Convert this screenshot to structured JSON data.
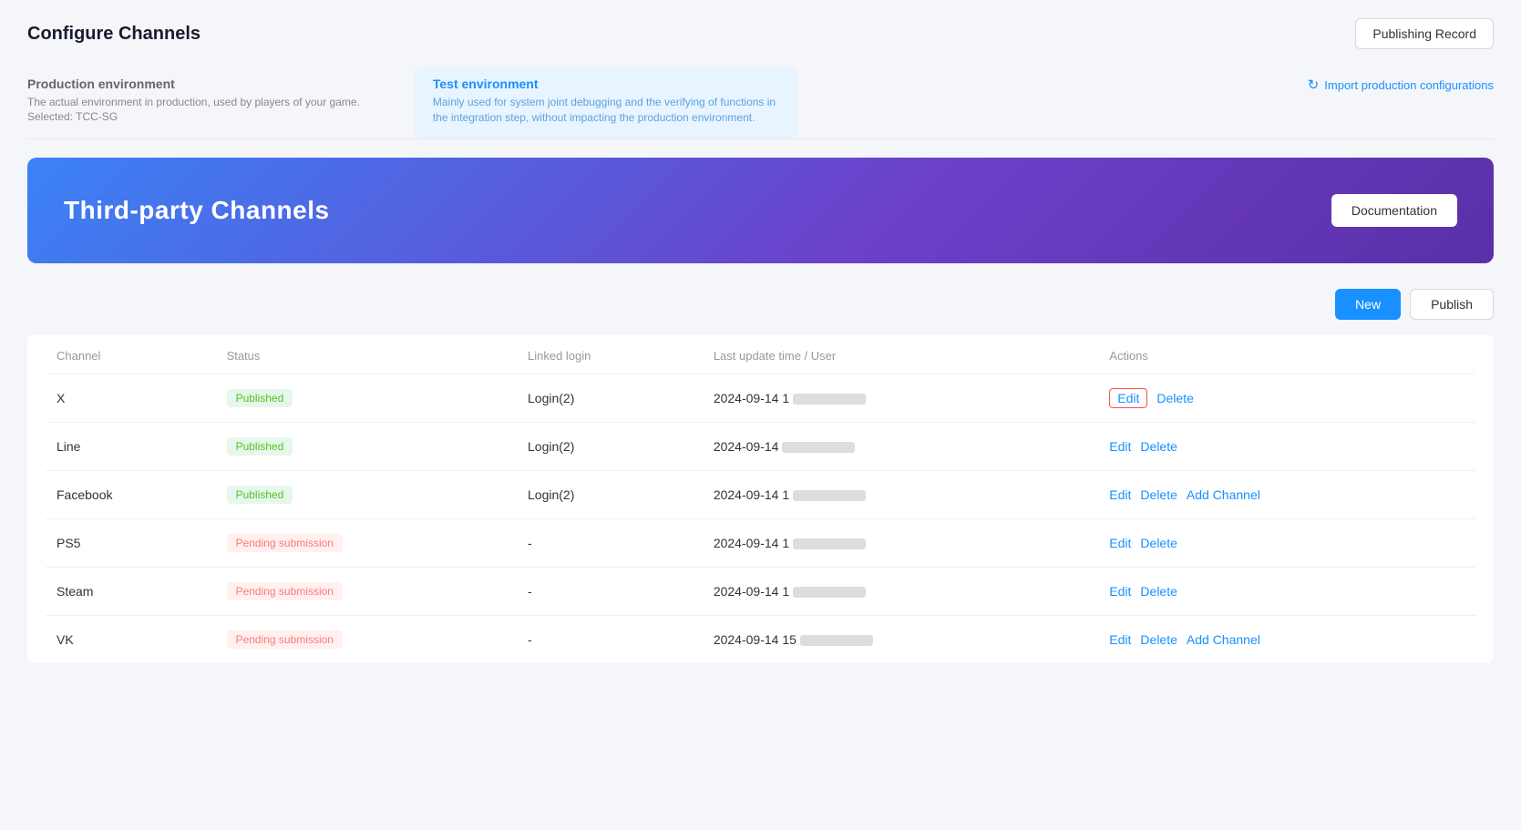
{
  "header": {
    "title": "Configure Channels",
    "publishing_record_label": "Publishing Record"
  },
  "env_tabs": [
    {
      "id": "production",
      "title": "Production environment",
      "description": "The actual environment in production, used by players of your game.",
      "selected": "Selected: TCC-SG",
      "active": false
    },
    {
      "id": "test",
      "title": "Test environment",
      "description": "Mainly used for system joint debugging and the verifying of functions in the integration step, without impacting the production environment.",
      "selected": "",
      "active": true
    }
  ],
  "import_link": "Import production configurations",
  "banner": {
    "title": "Third-party Channels",
    "documentation_label": "Documentation"
  },
  "toolbar": {
    "new_label": "New",
    "publish_label": "Publish"
  },
  "table": {
    "columns": [
      "Channel",
      "Status",
      "Linked login",
      "Last update time / User",
      "Actions"
    ],
    "rows": [
      {
        "channel": "X",
        "status": "Published",
        "status_type": "published",
        "linked_login": "Login(2)",
        "last_update": "2024-09-14 1",
        "actions": [
          "edit_outlined",
          "delete"
        ],
        "has_add": false
      },
      {
        "channel": "Line",
        "status": "Published",
        "status_type": "published",
        "linked_login": "Login(2)",
        "last_update": "2024-09-14",
        "actions": [
          "edit",
          "delete"
        ],
        "has_add": false
      },
      {
        "channel": "Facebook",
        "status": "Published",
        "status_type": "published",
        "linked_login": "Login(2)",
        "last_update": "2024-09-14 1",
        "actions": [
          "edit",
          "delete"
        ],
        "has_add": true
      },
      {
        "channel": "PS5",
        "status": "Pending submission",
        "status_type": "pending",
        "linked_login": "-",
        "last_update": "2024-09-14 1",
        "actions": [
          "edit",
          "delete"
        ],
        "has_add": false
      },
      {
        "channel": "Steam",
        "status": "Pending submission",
        "status_type": "pending",
        "linked_login": "-",
        "last_update": "2024-09-14 1",
        "actions": [
          "edit",
          "delete"
        ],
        "has_add": false
      },
      {
        "channel": "VK",
        "status": "Pending submission",
        "status_type": "pending",
        "linked_login": "-",
        "last_update": "2024-09-14 15",
        "actions": [
          "edit",
          "delete"
        ],
        "has_add": true
      }
    ]
  },
  "action_labels": {
    "edit": "Edit",
    "delete": "Delete",
    "add_channel": "Add Channel"
  }
}
